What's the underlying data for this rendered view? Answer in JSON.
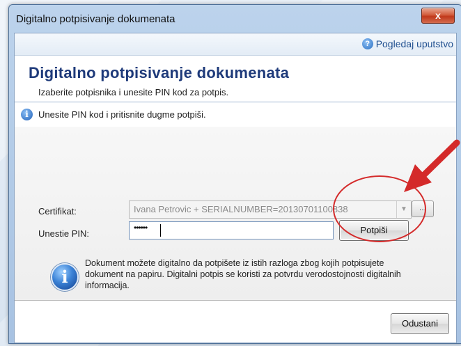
{
  "window": {
    "title": "Digitalno potpisivanje dokumenata",
    "close_label": "x"
  },
  "help": {
    "label": "Pogledaj uputstvo",
    "icon": "help-icon",
    "icon_glyph": "?"
  },
  "header": {
    "title": "Digitalno potpisivanje dokumenata",
    "subtitle": "Izaberite potpisnika i unesite PIN kod za potpis."
  },
  "info_bar": {
    "icon": "info-icon",
    "glyph": "i",
    "text": "Unesite PIN kod i pritisnite dugme potpiši."
  },
  "form": {
    "certificate_label": "Certifikat:",
    "certificate_value": "Ivana Petrovic + SERIALNUMBER=20130701100838",
    "browse_label": "...",
    "dropdown_glyph": "▼",
    "pin_label": "Unestie PIN:",
    "pin_value": "••••••",
    "sign_button": "Potpiši"
  },
  "note": {
    "icon": "info-icon",
    "glyph": "i",
    "text": "Dokument možete digitalno da potpišete iz istih razloga zbog kojih potpisujete dokument na papiru. Digitalni potpis se koristi za potvrdu verodostojnosti digitalnih informacija."
  },
  "footer": {
    "cancel_button": "Odustani"
  },
  "annotation": {
    "color": "#d42a2a"
  }
}
